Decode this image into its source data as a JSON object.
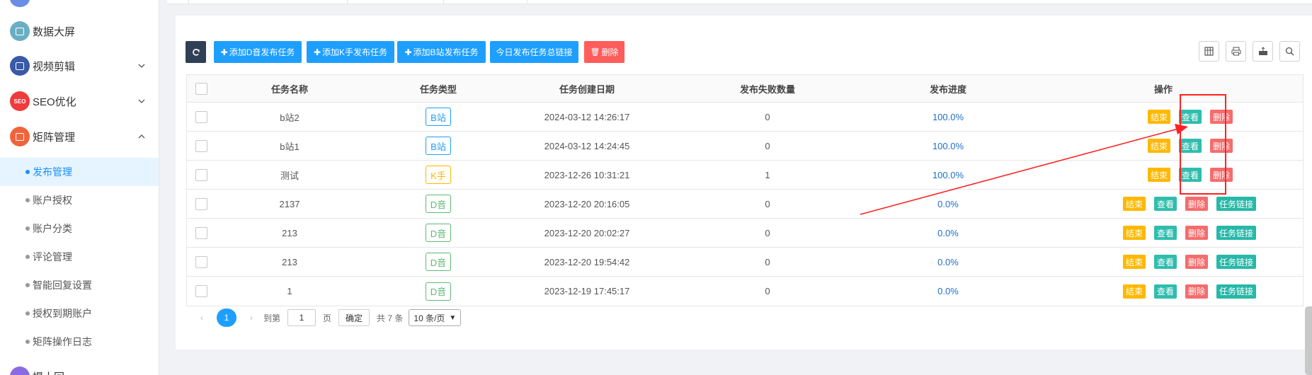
{
  "sidebar": {
    "menus": [
      {
        "label": "数据大屏",
        "icon": "screen-icon",
        "color": "#6aaec4",
        "expandable": false
      },
      {
        "label": "视频剪辑",
        "icon": "video-icon",
        "color": "#3a5aa8",
        "expandable": true,
        "expanded": false
      },
      {
        "label": "SEO优化",
        "icon": "seo-icon",
        "icon_text": "SEO",
        "color": "#ef3b3b",
        "expandable": true,
        "expanded": false
      },
      {
        "label": "矩阵管理",
        "icon": "matrix-icon",
        "color": "#f0643c",
        "expandable": true,
        "expanded": true
      }
    ],
    "sub_items": [
      {
        "label": "发布管理",
        "active": true
      },
      {
        "label": "账户授权",
        "active": false
      },
      {
        "label": "账户分类",
        "active": false
      },
      {
        "label": "评论管理",
        "active": false
      },
      {
        "label": "智能回复设置",
        "active": false
      },
      {
        "label": "授权到期账户",
        "active": false
      },
      {
        "label": "矩阵操作日志",
        "active": false
      }
    ],
    "partial_bottom_label": "提十回"
  },
  "toolbar": {
    "refresh_icon": "refresh-icon",
    "add_d_label": "添加D音发布任务",
    "add_k_label": "添加K手发布任务",
    "add_b_label": "添加B站发布任务",
    "today_link_label": "今日发布任务总链接",
    "delete_label": "删除",
    "right_icons": [
      "columns-icon",
      "print-icon",
      "export-icon",
      "search-icon"
    ]
  },
  "table": {
    "headers": {
      "name": "任务名称",
      "type": "任务类型",
      "created": "任务创建日期",
      "failed": "发布失败数量",
      "progress": "发布进度",
      "ops": "操作"
    },
    "rows": [
      {
        "name": "b站2",
        "type": "B站",
        "type_color": "#1e9fff",
        "created": "2024-03-12 14:26:17",
        "failed": "0",
        "progress": "100.0%",
        "ops": [
          "结束",
          "查看",
          "删除"
        ]
      },
      {
        "name": "b站1",
        "type": "B站",
        "type_color": "#1e9fff",
        "created": "2024-03-12 14:24:45",
        "failed": "0",
        "progress": "100.0%",
        "ops": [
          "结束",
          "查看",
          "删除"
        ]
      },
      {
        "name": "测试",
        "type": "K手",
        "type_color": "#ffb800",
        "created": "2023-12-26 10:31:21",
        "failed": "1",
        "progress": "100.0%",
        "ops": [
          "结束",
          "查看",
          "删除"
        ]
      },
      {
        "name": "2137",
        "type": "D音",
        "type_color": "#5fb878",
        "created": "2023-12-20 20:16:05",
        "failed": "0",
        "progress": "0.0%",
        "ops": [
          "结束",
          "查看",
          "删除",
          "任务链接"
        ]
      },
      {
        "name": "213",
        "type": "D音",
        "type_color": "#5fb878",
        "created": "2023-12-20 20:02:27",
        "failed": "0",
        "progress": "0.0%",
        "ops": [
          "结束",
          "查看",
          "删除",
          "任务链接"
        ]
      },
      {
        "name": "213",
        "type": "D音",
        "type_color": "#5fb878",
        "created": "2023-12-20 19:54:42",
        "failed": "0",
        "progress": "0.0%",
        "ops": [
          "结束",
          "查看",
          "删除",
          "任务链接"
        ]
      },
      {
        "name": "1",
        "type": "D音",
        "type_color": "#5fb878",
        "created": "2023-12-19 17:45:17",
        "failed": "0",
        "progress": "0.0%",
        "ops": [
          "结束",
          "查看",
          "删除",
          "任务链接"
        ]
      }
    ]
  },
  "pagination": {
    "current_page": "1",
    "goto_label": "到第",
    "goto_value": "1",
    "page_unit": "页",
    "confirm_label": "确定",
    "total_label": "共 7 条",
    "page_size_label": "10 条/页"
  },
  "annotation": {
    "color": "#ff2222"
  }
}
